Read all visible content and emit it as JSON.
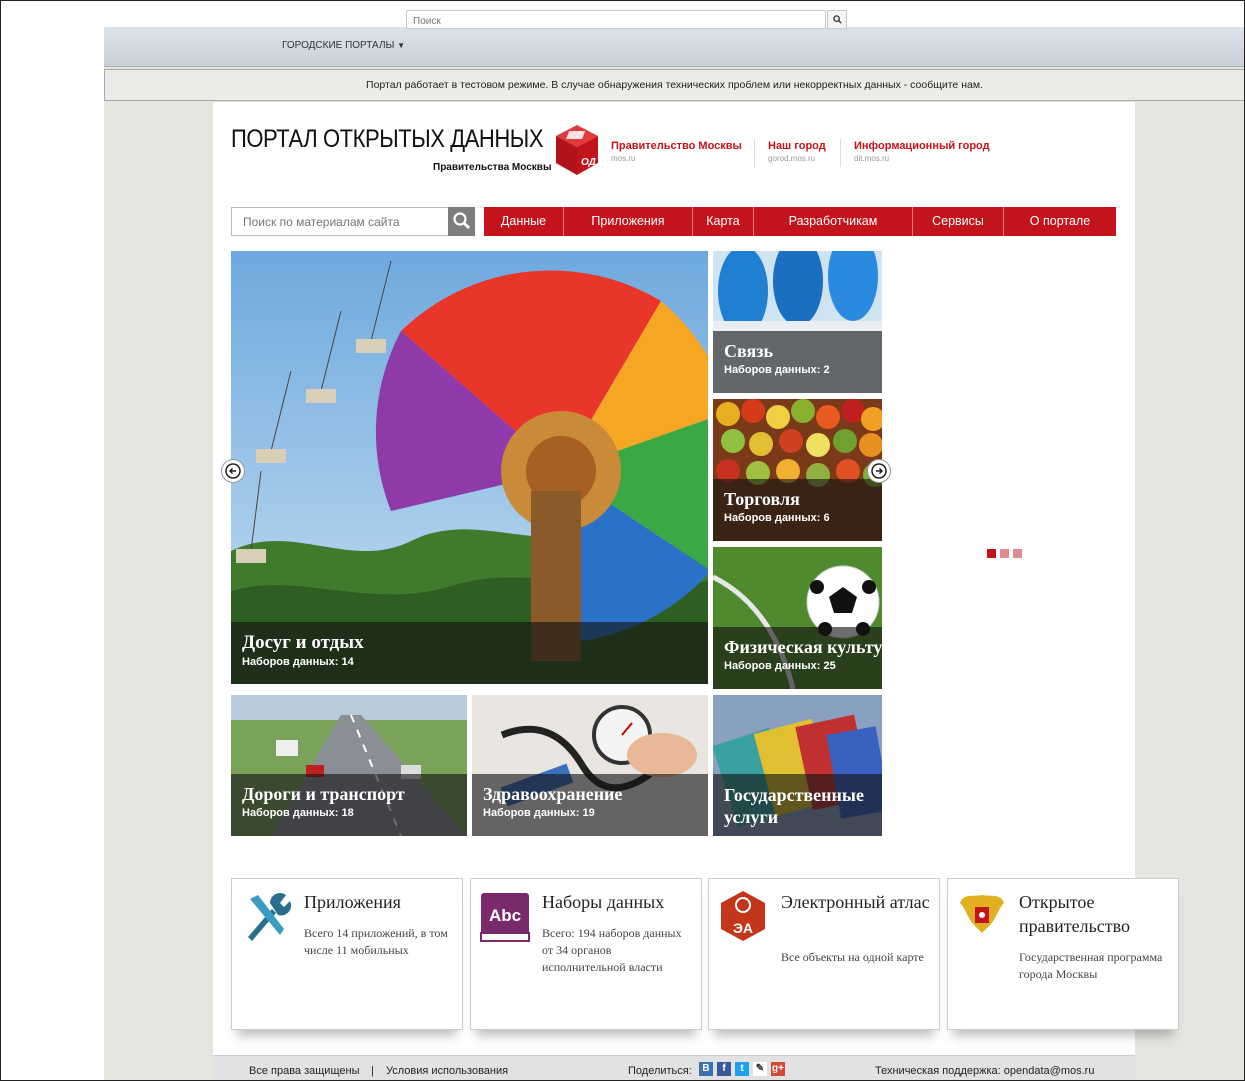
{
  "topbar": {
    "portals_label": "ГОРОДСКИЕ ПОРТАЛЫ",
    "search_placeholder": "Поиск"
  },
  "notice": "Портал работает в тестовом режиме. В случае обнаружения технических проблем или некорректных данных - сообщите нам.",
  "header": {
    "title": "ПОРТАЛ ОТКРЫТЫХ ДАННЫХ",
    "subtitle": "Правительства Москвы",
    "logo_text": "ОД",
    "links": [
      {
        "title": "Правительство Москвы",
        "url": "mos.ru"
      },
      {
        "title": "Наш город",
        "url": "gorod.mos.ru"
      },
      {
        "title": "Информационный город",
        "url": "dit.mos.ru"
      }
    ]
  },
  "site_search": {
    "placeholder": "Поиск по материалам сайта"
  },
  "nav": [
    "Данные",
    "Приложения",
    "Карта",
    "Разработчикам",
    "Сервисы",
    "О портале"
  ],
  "tiles": [
    {
      "name": "Досуг и отдых",
      "count": "Наборов данных: 14"
    },
    {
      "name": "Связь",
      "count": "Наборов данных: 2"
    },
    {
      "name": "Торговля",
      "count": "Наборов данных: 6"
    },
    {
      "name": "Физическая культура",
      "count": "Наборов данных: 25"
    },
    {
      "name": "Дороги и транспорт",
      "count": "Наборов данных: 18"
    },
    {
      "name": "Здравоохранение",
      "count": "Наборов данных: 19"
    },
    {
      "name": "Государственные услуги",
      "count": ""
    }
  ],
  "carousel": {
    "dots": 3,
    "active": 0
  },
  "cards": [
    {
      "title": "Приложения",
      "desc": "Всего 14 приложений, в том числе 11 мобильных",
      "icon": "tools-icon"
    },
    {
      "title": "Наборы данных",
      "desc": "Всего: 194 наборов данных от 34 органов исполнительной власти",
      "icon": "abc-book-icon",
      "icon_text": "Abc"
    },
    {
      "title": "Электронный атлас",
      "desc": "Все объекты на одной карте",
      "icon": "atlas-icon",
      "icon_text": "ЭА"
    },
    {
      "title": "Открытое правительство",
      "desc": "Государственная программа города Москвы",
      "icon": "coat-of-arms-icon"
    }
  ],
  "footer": {
    "rights": "Все права защищены",
    "sep": "|",
    "terms": "Условия использования",
    "share": "Поделиться:",
    "support": "Техническая поддержка: opendata@mos.ru"
  },
  "colors": {
    "brand_red": "#c4141b"
  }
}
